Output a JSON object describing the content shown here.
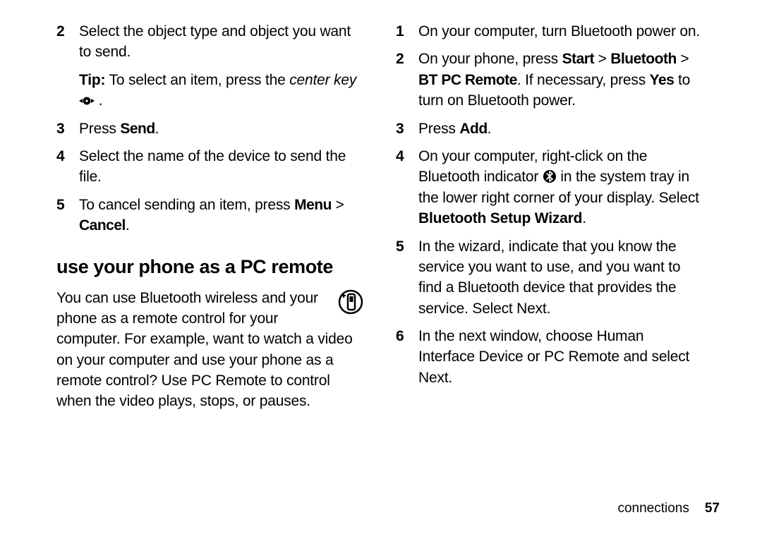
{
  "left": {
    "items": [
      {
        "num": "2",
        "text": "Select the object type and object you want to send."
      },
      {
        "num": "",
        "tip_lead": "Tip:",
        "tip_rest": " To select an item, press the ",
        "italic": "center key",
        "tail": " ."
      },
      {
        "num": "3",
        "lead": "Press ",
        "bold": "Send",
        "tail": "."
      },
      {
        "num": "4",
        "text": "Select the name of the device to send the file."
      },
      {
        "num": "5",
        "lead": "To cancel sending an item, press ",
        "bold1": "Menu",
        "mid": " > ",
        "bold2": "Cancel",
        "tail": "."
      }
    ],
    "heading": "use your phone as a PC remote",
    "para": "You can use Bluetooth wireless and your phone as a remote control for your computer. For example, want to watch a video on your computer and use your phone as a remote control? Use PC Remote to control when the video plays, stops, or pauses."
  },
  "right": {
    "items": [
      {
        "num": "1",
        "text": "On your computer, turn Bluetooth power on."
      },
      {
        "num": "2",
        "lead": "On your phone, press ",
        "b1": "Start",
        "m1": " > ",
        "b2": "Bluetooth",
        "m2": " > ",
        "b3": "BT PC Remote",
        "mid": ". If necessary, press ",
        "b4": "Yes",
        "tail": " to turn on Bluetooth power."
      },
      {
        "num": "3",
        "lead": "Press ",
        "bold": "Add",
        "tail": "."
      },
      {
        "num": "4",
        "lead": "On your computer, right-click on the Bluetooth indicator ",
        "mid": " in the system tray in the lower right corner of your display. Select ",
        "strong": "Bluetooth Setup Wizard",
        "tail": "."
      },
      {
        "num": "5",
        "text": "In the wizard, indicate that you know the service you want to use, and you want to find a Bluetooth device that provides the service. Select Next."
      },
      {
        "num": "6",
        "text": "In the next window, choose Human Interface Device or PC Remote and select Next."
      }
    ]
  },
  "footer": {
    "label": "connections",
    "page": "57"
  }
}
